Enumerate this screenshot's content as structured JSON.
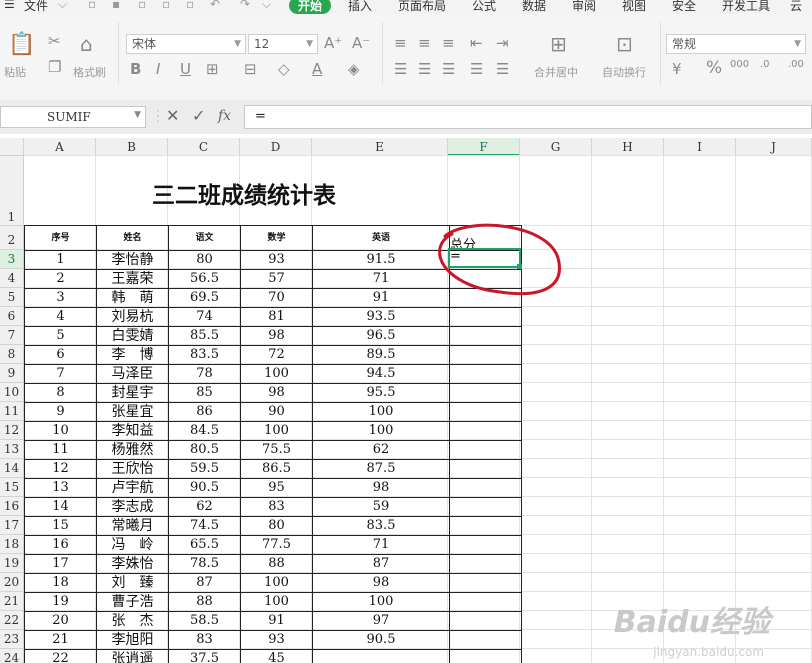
{
  "menu": {
    "file": "文件",
    "tabs": [
      "开始",
      "插入",
      "页面布局",
      "公式",
      "数据",
      "审阅",
      "视图",
      "安全",
      "开发工具",
      "云"
    ]
  },
  "toolbar": {
    "paste": "粘贴",
    "format_painter": "格式刷",
    "font_name": "宋体",
    "font_size": "12",
    "merge_center": "合并居中",
    "wrap_text": "自动换行",
    "number_format": "常规",
    "percent": "%"
  },
  "formula_bar": {
    "name_box": "SUMIF",
    "fx": "fx",
    "value": "="
  },
  "columns": [
    "A",
    "B",
    "C",
    "D",
    "E",
    "F",
    "G",
    "H",
    "I",
    "J"
  ],
  "rows": [
    "1",
    "2",
    "3",
    "4",
    "5",
    "6",
    "7",
    "8",
    "9",
    "10",
    "11",
    "12",
    "13",
    "14",
    "15",
    "16",
    "17",
    "18",
    "19",
    "20",
    "21",
    "22",
    "23",
    "24"
  ],
  "sheet": {
    "title": "三二班成绩统计表",
    "headers": [
      "序号",
      "姓名",
      "语文",
      "数学",
      "英语"
    ],
    "total_label": "总分",
    "active_cell_text": "=",
    "records": [
      [
        "1",
        "李怡静",
        "80",
        "93",
        "91.5"
      ],
      [
        "2",
        "王嘉荣",
        "56.5",
        "57",
        "71"
      ],
      [
        "3",
        "韩　萌",
        "69.5",
        "70",
        "91"
      ],
      [
        "4",
        "刘易杭",
        "74",
        "81",
        "93.5"
      ],
      [
        "5",
        "白雯婧",
        "85.5",
        "98",
        "96.5"
      ],
      [
        "6",
        "李　博",
        "83.5",
        "72",
        "89.5"
      ],
      [
        "7",
        "马泽臣",
        "78",
        "100",
        "94.5"
      ],
      [
        "8",
        "封星宇",
        "85",
        "98",
        "95.5"
      ],
      [
        "9",
        "张星宜",
        "86",
        "90",
        "100"
      ],
      [
        "10",
        "李知益",
        "84.5",
        "100",
        "100"
      ],
      [
        "11",
        "杨雅然",
        "80.5",
        "75.5",
        "62"
      ],
      [
        "12",
        "王欣怡",
        "59.5",
        "86.5",
        "87.5"
      ],
      [
        "13",
        "卢宇航",
        "90.5",
        "95",
        "98"
      ],
      [
        "14",
        "李志成",
        "62",
        "83",
        "59"
      ],
      [
        "15",
        "常曦月",
        "74.5",
        "80",
        "83.5"
      ],
      [
        "16",
        "冯　岭",
        "65.5",
        "77.5",
        "71"
      ],
      [
        "17",
        "李姝怡",
        "78.5",
        "88",
        "87"
      ],
      [
        "18",
        "刘　臻",
        "87",
        "100",
        "98"
      ],
      [
        "19",
        "曹子浩",
        "88",
        "100",
        "100"
      ],
      [
        "20",
        "张　杰",
        "58.5",
        "91",
        "97"
      ],
      [
        "21",
        "李旭阳",
        "83",
        "93",
        "90.5"
      ],
      [
        "22",
        "张逍遥",
        "37.5",
        "45",
        ""
      ]
    ]
  },
  "watermark": {
    "logo": "Baidu经验",
    "url": "jingyan.baidu.com"
  },
  "colors": {
    "accent": "#21a366",
    "annotation": "#c8182a"
  }
}
